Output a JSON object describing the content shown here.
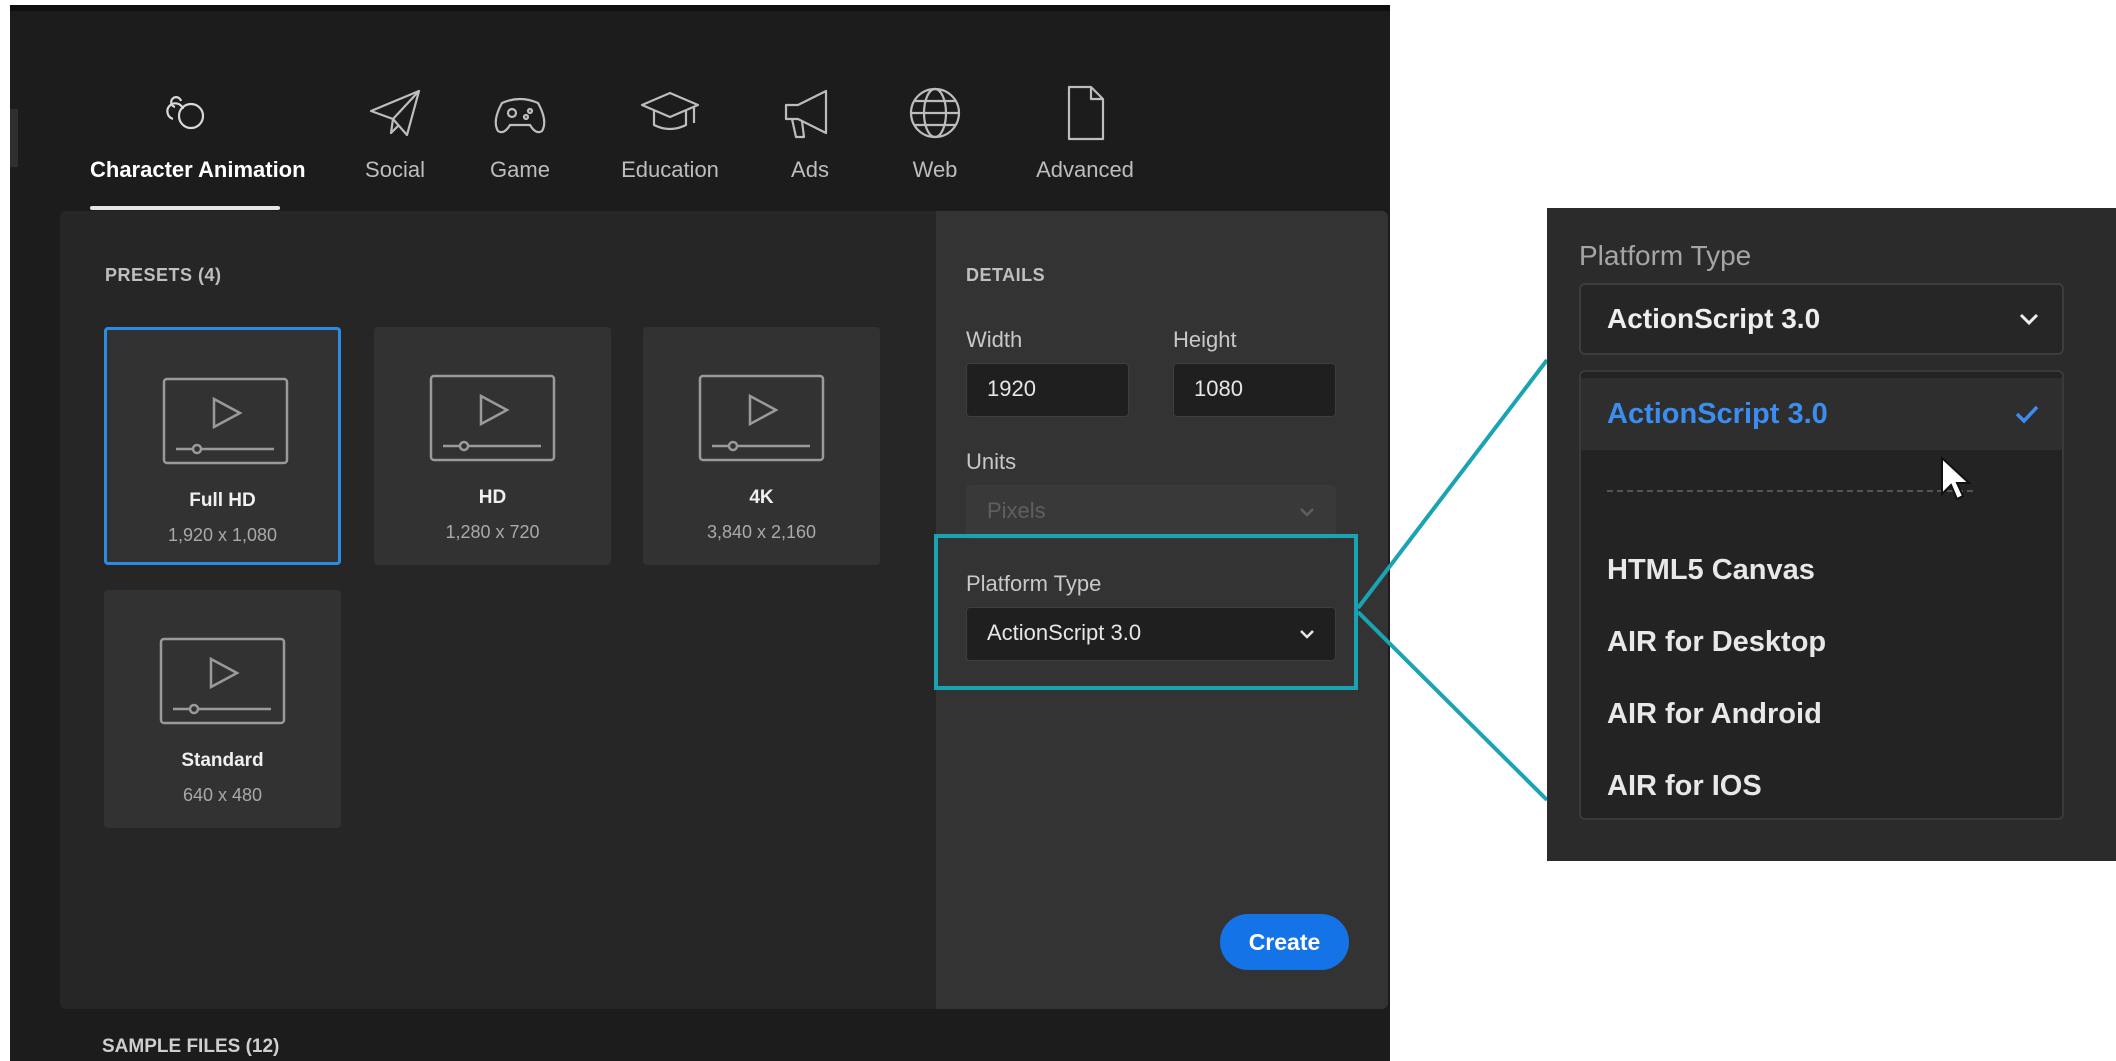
{
  "tabs": [
    {
      "label": "Character Animation",
      "icon": "character-animation-icon",
      "active": true
    },
    {
      "label": "Social",
      "icon": "paper-plane-icon"
    },
    {
      "label": "Game",
      "icon": "gamepad-icon"
    },
    {
      "label": "Education",
      "icon": "graduation-cap-icon"
    },
    {
      "label": "Ads",
      "icon": "megaphone-icon"
    },
    {
      "label": "Web",
      "icon": "globe-icon"
    },
    {
      "label": "Advanced",
      "icon": "document-icon"
    }
  ],
  "presets": {
    "title": "PRESETS (4)",
    "items": [
      {
        "name": "Full HD",
        "size": "1,920 x 1,080",
        "selected": true
      },
      {
        "name": "HD",
        "size": "1,280 x 720"
      },
      {
        "name": "4K",
        "size": "3,840 x 2,160"
      },
      {
        "name": "Standard",
        "size": "640 x 480"
      }
    ]
  },
  "details": {
    "title": "DETAILS",
    "width_label": "Width",
    "width_value": "1920",
    "height_label": "Height",
    "height_value": "1080",
    "units_label": "Units",
    "units_value": "Pixels",
    "platform_label": "Platform Type",
    "platform_value": "ActionScript 3.0"
  },
  "create_label": "Create",
  "sample_files_title": "SAMPLE FILES (12)",
  "zoom": {
    "label": "Platform Type",
    "value": "ActionScript 3.0",
    "options": [
      {
        "label": "ActionScript 3.0",
        "selected": true
      },
      {
        "label": "HTML5 Canvas"
      },
      {
        "label": "AIR for Desktop"
      },
      {
        "label": "AIR for Android"
      },
      {
        "label": "AIR for IOS"
      }
    ]
  },
  "colors": {
    "accent": "#2b8ce6",
    "create_button": "#1473e6",
    "callout": "#1aa3b3",
    "selected_option": "#3b8df0"
  }
}
